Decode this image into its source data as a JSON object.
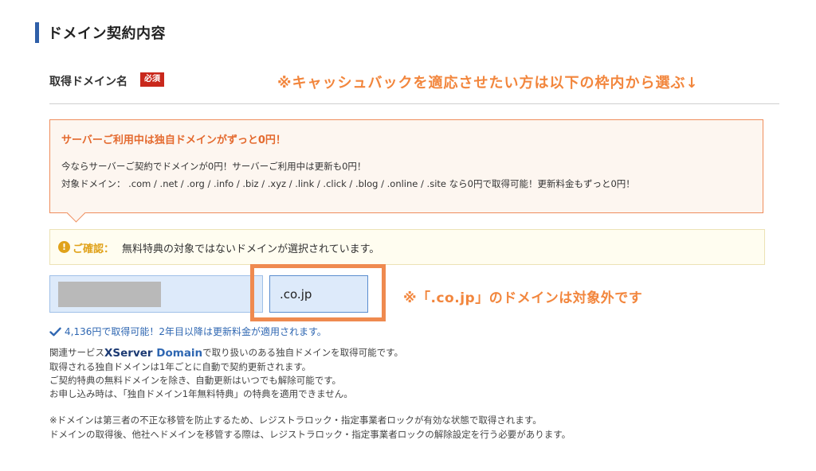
{
  "section": {
    "title": "ドメイン契約内容"
  },
  "field": {
    "label": "取得ドメイン名",
    "required_badge": "必須",
    "cashback_note": "※キャッシュバックを適応させたい方は以下の枠内から選ぶ↓"
  },
  "promo": {
    "title": "サーバーご利用中は独自ドメインがずっと0円！",
    "line1": "今ならサーバーご契約でドメインが0円！サーバーご利用中は更新も0円！",
    "line2": "対象ドメイン： .com / .net / .org / .info / .biz / .xyz / .link / .click / .blog / .online / .site なら0円で取得可能！更新料金もずっと0円！"
  },
  "confirm": {
    "icon": "!",
    "label": "ご確認：",
    "text": "無料特典の対象ではないドメインが選択されています。"
  },
  "domain_input": {
    "tld_value": ".co.jp"
  },
  "tld_note": "※「.co.jp」のドメインは対象外です",
  "price_line": "4,136円で取得可能！2年目以降は更新料金が適用されます。",
  "description": {
    "line1_prefix": "関連サービス",
    "logo_part1": "XServer",
    "logo_part2": "Domain",
    "line1_suffix": "で取り扱いのある独自ドメインを取得可能です。",
    "line2": "取得される独自ドメインは1年ごとに自動で契約更新されます。",
    "line3": "ご契約特典の無料ドメインを除き、自動更新はいつでも解除可能です。",
    "line4": "お申し込み時は、「独自ドメイン1年無料特典」の特典を適用できません。"
  },
  "note": {
    "line1": "※ドメインは第三者の不正な移管を防止するため、レジストラロック・指定事業者ロックが有効な状態で取得されます。",
    "line2": "ドメインの取得後、他社へドメインを移管する際は、レジストラロック・指定事業者ロックの解除設定を行う必要があります。"
  },
  "colors": {
    "accent_orange": "#f2863d",
    "brand_blue": "#2f5fa8",
    "required_red": "#c9281c",
    "warning_yellow": "#e0a21a",
    "input_bg": "#ddeafa"
  }
}
